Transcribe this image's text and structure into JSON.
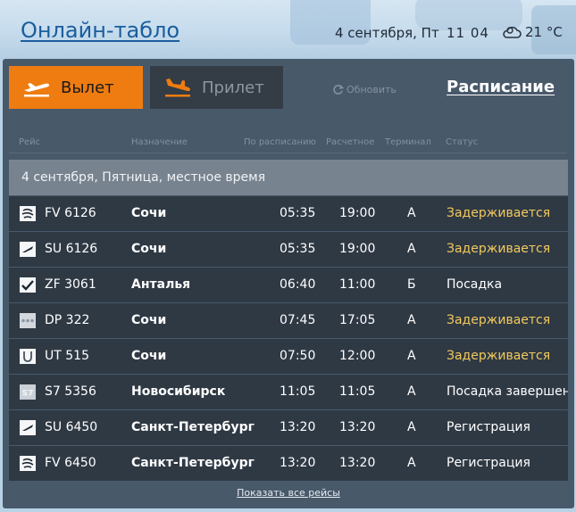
{
  "header": {
    "title": "Онлайн-табло",
    "date": "4 сентября, Пт",
    "time": "11 04",
    "weather": "21 °C",
    "weather_icon": "cloud-icon"
  },
  "tabs": {
    "departure": "Вылет",
    "arrival": "Прилет",
    "refresh": "Обновить",
    "schedule": "Расписание"
  },
  "columns": {
    "flight": "Рейс",
    "destination": "Назначение",
    "scheduled": "По расписанию",
    "estimated": "Расчетное",
    "terminal": "Терминал",
    "status": "Статус"
  },
  "date_row": "4 сентября, Пятница, местное время",
  "flights": [
    {
      "flight": "FV 6126",
      "destination": "Сочи",
      "scheduled": "05:35",
      "estimated": "19:00",
      "terminal": "A",
      "status": "Задерживается",
      "delayed": true
    },
    {
      "flight": "SU 6126",
      "destination": "Сочи",
      "scheduled": "05:35",
      "estimated": "19:00",
      "terminal": "A",
      "status": "Задерживается",
      "delayed": true
    },
    {
      "flight": "ZF 3061",
      "destination": "Анталья",
      "scheduled": "06:40",
      "estimated": "11:00",
      "terminal": "Б",
      "status": "Посадка",
      "delayed": false
    },
    {
      "flight": "DP 322",
      "destination": "Сочи",
      "scheduled": "07:45",
      "estimated": "17:05",
      "terminal": "A",
      "status": "Задерживается",
      "delayed": true
    },
    {
      "flight": "UT 515",
      "destination": "Сочи",
      "scheduled": "07:50",
      "estimated": "12:00",
      "terminal": "A",
      "status": "Задерживается",
      "delayed": true
    },
    {
      "flight": "S7 5356",
      "destination": "Новосибирск",
      "scheduled": "11:05",
      "estimated": "11:05",
      "terminal": "A",
      "status": "Посадка завершена",
      "delayed": false
    },
    {
      "flight": "SU 6450",
      "destination": "Санкт-Петербург",
      "scheduled": "13:20",
      "estimated": "13:20",
      "terminal": "A",
      "status": "Регистрация",
      "delayed": false
    },
    {
      "flight": "FV 6450",
      "destination": "Санкт-Петербург",
      "scheduled": "13:20",
      "estimated": "13:20",
      "terminal": "A",
      "status": "Регистрация",
      "delayed": false
    }
  ],
  "show_all": "Показать все рейсы",
  "colors": {
    "accent": "#ef7c10",
    "delayed": "#f2c95c",
    "panel": "#48596a",
    "row": "#2f3944"
  }
}
